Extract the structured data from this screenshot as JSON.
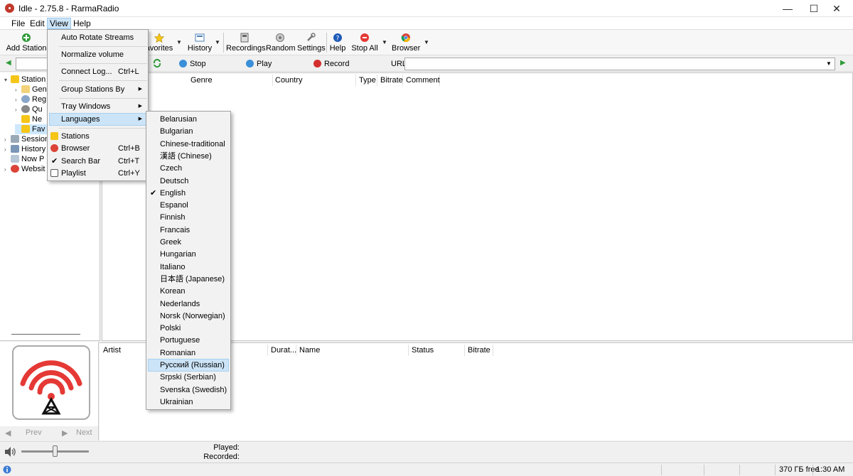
{
  "window": {
    "title": "Idle - 2.75.8 - RarmaRadio",
    "minimize": "—",
    "maximize": "☐",
    "close": "✕"
  },
  "menubar": {
    "file": "File",
    "edit": "Edit",
    "view": "View",
    "help": "Help"
  },
  "toolbar": {
    "add_station": "Add Station",
    "favorites": "avorites",
    "history": "History",
    "recordings": "Recordings",
    "random": "Random",
    "settings": "Settings",
    "help": "Help",
    "stop_all": "Stop All",
    "browser": "Browser"
  },
  "controls": {
    "stop": "Stop",
    "play": "Play",
    "record": "Record",
    "url_label": "URL",
    "url_value": ""
  },
  "tree": {
    "items": [
      {
        "label": "Station"
      },
      {
        "label": "Gen"
      },
      {
        "label": "Reg"
      },
      {
        "label": "Qu"
      },
      {
        "label": "Ne"
      },
      {
        "label": "Fav"
      },
      {
        "label": "Session"
      },
      {
        "label": "History"
      },
      {
        "label": "Now P"
      },
      {
        "label": "Websit"
      }
    ]
  },
  "main_columns": {
    "genre": "Genre",
    "country": "Country",
    "type": "Type",
    "bitrate": "Bitrate",
    "comment": "Comment"
  },
  "bottom_columns": {
    "artist": "Artist",
    "duration": "Durat...",
    "name": "Name",
    "status": "Status",
    "bitrate": "Bitrate"
  },
  "nav": {
    "prev": "Prev",
    "next": "Next"
  },
  "playback": {
    "played_label": "Played:",
    "recorded_label": "Recorded:"
  },
  "statusbar": {
    "free_space": "370 ГБ free",
    "time": "1:30 AM"
  },
  "view_menu": {
    "items": [
      {
        "label": "Auto Rotate Streams",
        "shortcut": ""
      },
      {
        "label": "Normalize volume",
        "shortcut": ""
      },
      {
        "label": "Connect Log...",
        "shortcut": "Ctrl+L"
      },
      {
        "label": "Group Stations By",
        "shortcut": ""
      },
      {
        "label": "Tray Windows",
        "shortcut": ""
      },
      {
        "label": "Languages",
        "shortcut": ""
      },
      {
        "label": "Stations",
        "shortcut": ""
      },
      {
        "label": "Browser",
        "shortcut": "Ctrl+B"
      },
      {
        "label": "Search Bar",
        "shortcut": "Ctrl+T"
      },
      {
        "label": "Playlist",
        "shortcut": "Ctrl+Y"
      }
    ]
  },
  "languages_menu": {
    "items": [
      "Belarusian",
      "Bulgarian",
      "Chinese-traditional",
      "漢語 (Chinese)",
      "Czech",
      "Deutsch",
      "English",
      "Espanol",
      "Finnish",
      "Francais",
      "Greek",
      "Hungarian",
      "Italiano",
      "日本語 (Japanese)",
      "Korean",
      "Nederlands",
      "Norsk (Norwegian)",
      "Polski",
      "Portuguese",
      "Romanian",
      "Русский (Russian)",
      "Srpski (Serbian)",
      "Svenska (Swedish)",
      "Ukrainian"
    ],
    "checked": "English",
    "highlighted": "Русский (Russian)"
  },
  "colors": {
    "highlight": "#cce4f7",
    "accent_red": "#e53935",
    "menu_bg": "#f2f2f2"
  }
}
